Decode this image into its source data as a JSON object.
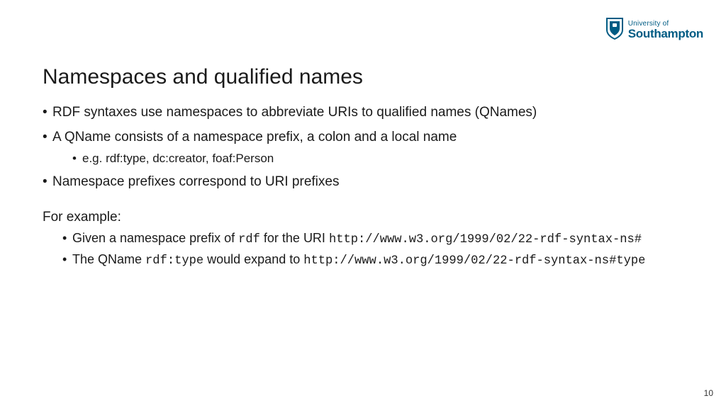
{
  "logo": {
    "line1": "University of",
    "line2": "Southampton"
  },
  "title": "Namespaces and qualified names",
  "bullets": [
    "RDF syntaxes use namespaces to abbreviate URIs to qualified names (QNames)",
    "A QName consists of a namespace prefix, a colon and a local name",
    "Namespace prefixes correspond to URI prefixes"
  ],
  "sub_example": "e.g. rdf:type, dc:creator, foaf:Person",
  "example_label": "For example:",
  "example_items": {
    "a_pre": "Given a namespace prefix of ",
    "a_code1": "rdf",
    "a_mid": " for the URI ",
    "a_code2": "http://www.w3.org/1999/02/22-rdf-syntax-ns#",
    "b_pre": "The QName ",
    "b_code1": "rdf:type",
    "b_mid": " would expand to ",
    "b_code2": "http://www.w3.org/1999/02/22-rdf-syntax-ns#type"
  },
  "page_number": "10"
}
